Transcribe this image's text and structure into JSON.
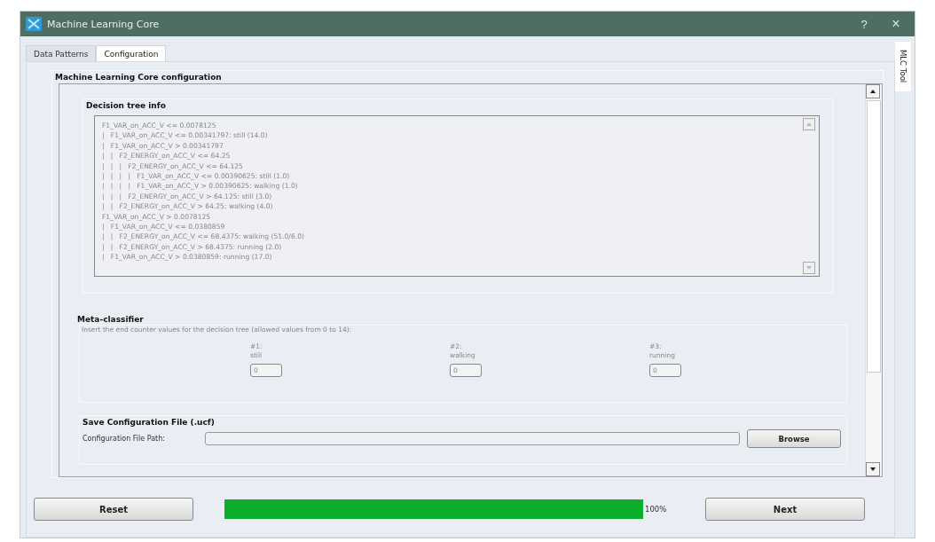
{
  "window": {
    "title": "Machine Learning Core",
    "help": "?",
    "close": "×"
  },
  "tabs": [
    {
      "label": "Data Patterns",
      "selected": false
    },
    {
      "label": "Configuration",
      "selected": true
    }
  ],
  "side_tab": {
    "label": "MLC Tool"
  },
  "configuration": {
    "title": "Machine Learning Core configuration",
    "decision_tree": {
      "title": "Decision tree info",
      "lines": [
        "F1_VAR_on_ACC_V <= 0.0078125",
        "|   F1_VAR_on_ACC_V <= 0.00341797: still (14.0)",
        "|   F1_VAR_on_ACC_V > 0.00341797",
        "|   |   F2_ENERGY_on_ACC_V <= 64.25",
        "|   |   |   F2_ENERGY_on_ACC_V <= 64.125",
        "|   |   |   |   F1_VAR_on_ACC_V <= 0.00390625: still (1.0)",
        "|   |   |   |   F1_VAR_on_ACC_V > 0.00390625: walking (1.0)",
        "|   |   |   F2_ENERGY_on_ACC_V > 64.125: still (3.0)",
        "|   |   F2_ENERGY_on_ACC_V > 64.25: walking (4.0)",
        "F1_VAR_on_ACC_V > 0.0078125",
        "|   F1_VAR_on_ACC_V <= 0.0380859",
        "|   |   F2_ENERGY_on_ACC_V <= 68.4375: walking (51.0/6.0)",
        "|   |   F2_ENERGY_on_ACC_V > 68.4375: running (2.0)",
        "|   F1_VAR_on_ACC_V > 0.0380859: running (17.0)"
      ]
    },
    "meta_classifier": {
      "title": "Meta-classifier",
      "instruction": "Insert the end counter values for the decision tree (allowed values from 0 to 14):",
      "counters": [
        {
          "index": "#1:",
          "label": "still",
          "value": "0"
        },
        {
          "index": "#2:",
          "label": "walking",
          "value": "0"
        },
        {
          "index": "#3:",
          "label": "running",
          "value": "0"
        }
      ]
    },
    "save": {
      "title": "Save Configuration File (.ucf)",
      "path_label": "Configuration File Path:",
      "button": "Browse"
    }
  },
  "footer": {
    "reset": "Reset",
    "progress": {
      "level": 1.0,
      "reading": "100%"
    },
    "next": "Next"
  }
}
